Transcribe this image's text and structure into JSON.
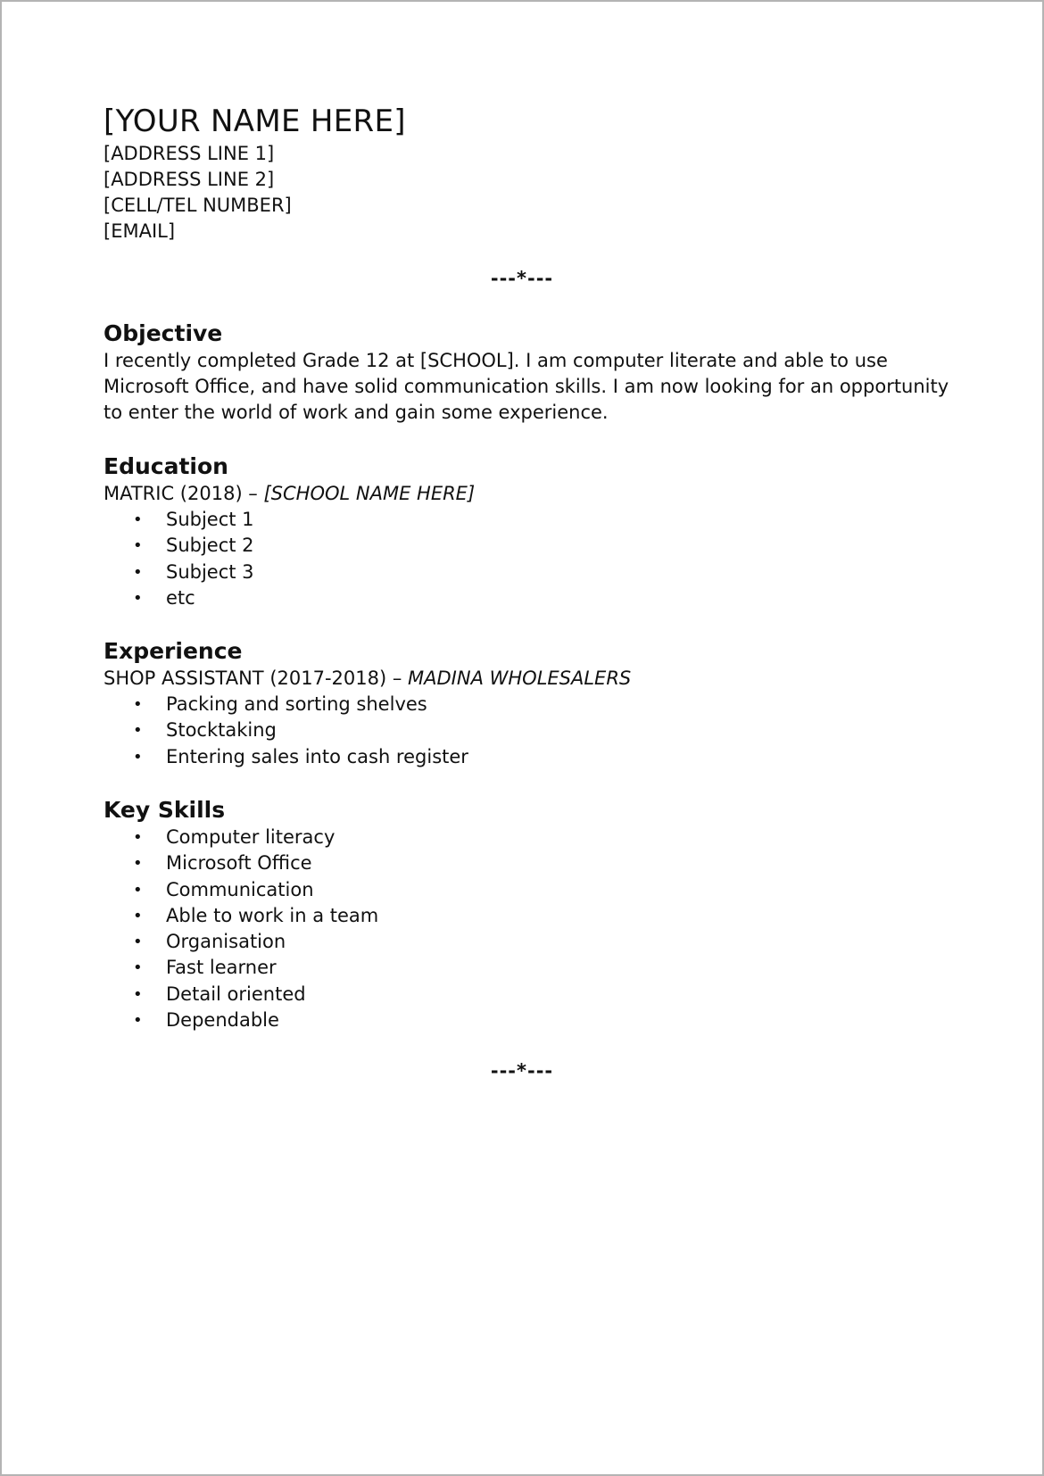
{
  "header": {
    "name": "[YOUR NAME HERE]",
    "contact": [
      "[ADDRESS LINE 1]",
      "[ADDRESS LINE 2]",
      "[CELL/TEL NUMBER]",
      "[EMAIL]"
    ]
  },
  "divider": "---*---",
  "objective": {
    "heading": "Objective",
    "text": "I recently completed Grade 12 at [SCHOOL]. I am computer literate and able to use Microsoft Office, and have solid communication skills. I am now looking for an opportunity to enter the world of work and gain some experience."
  },
  "education": {
    "heading": "Education",
    "qualification": "MATRIC (2018) – ",
    "school": "[SCHOOL NAME HERE]",
    "subjects": [
      "Subject 1",
      "Subject 2",
      "Subject 3",
      "etc"
    ]
  },
  "experience": {
    "heading": "Experience",
    "role": "SHOP ASSISTANT (2017-2018) – ",
    "employer": "MADINA WHOLESALERS",
    "duties": [
      "Packing and sorting shelves",
      "Stocktaking",
      "Entering sales into cash register"
    ]
  },
  "skills": {
    "heading": "Key Skills",
    "items": [
      "Computer literacy",
      "Microsoft Office",
      "Communication",
      "Able to work in a team",
      "Organisation",
      "Fast learner",
      "Detail oriented",
      "Dependable"
    ]
  },
  "bullet": "•"
}
